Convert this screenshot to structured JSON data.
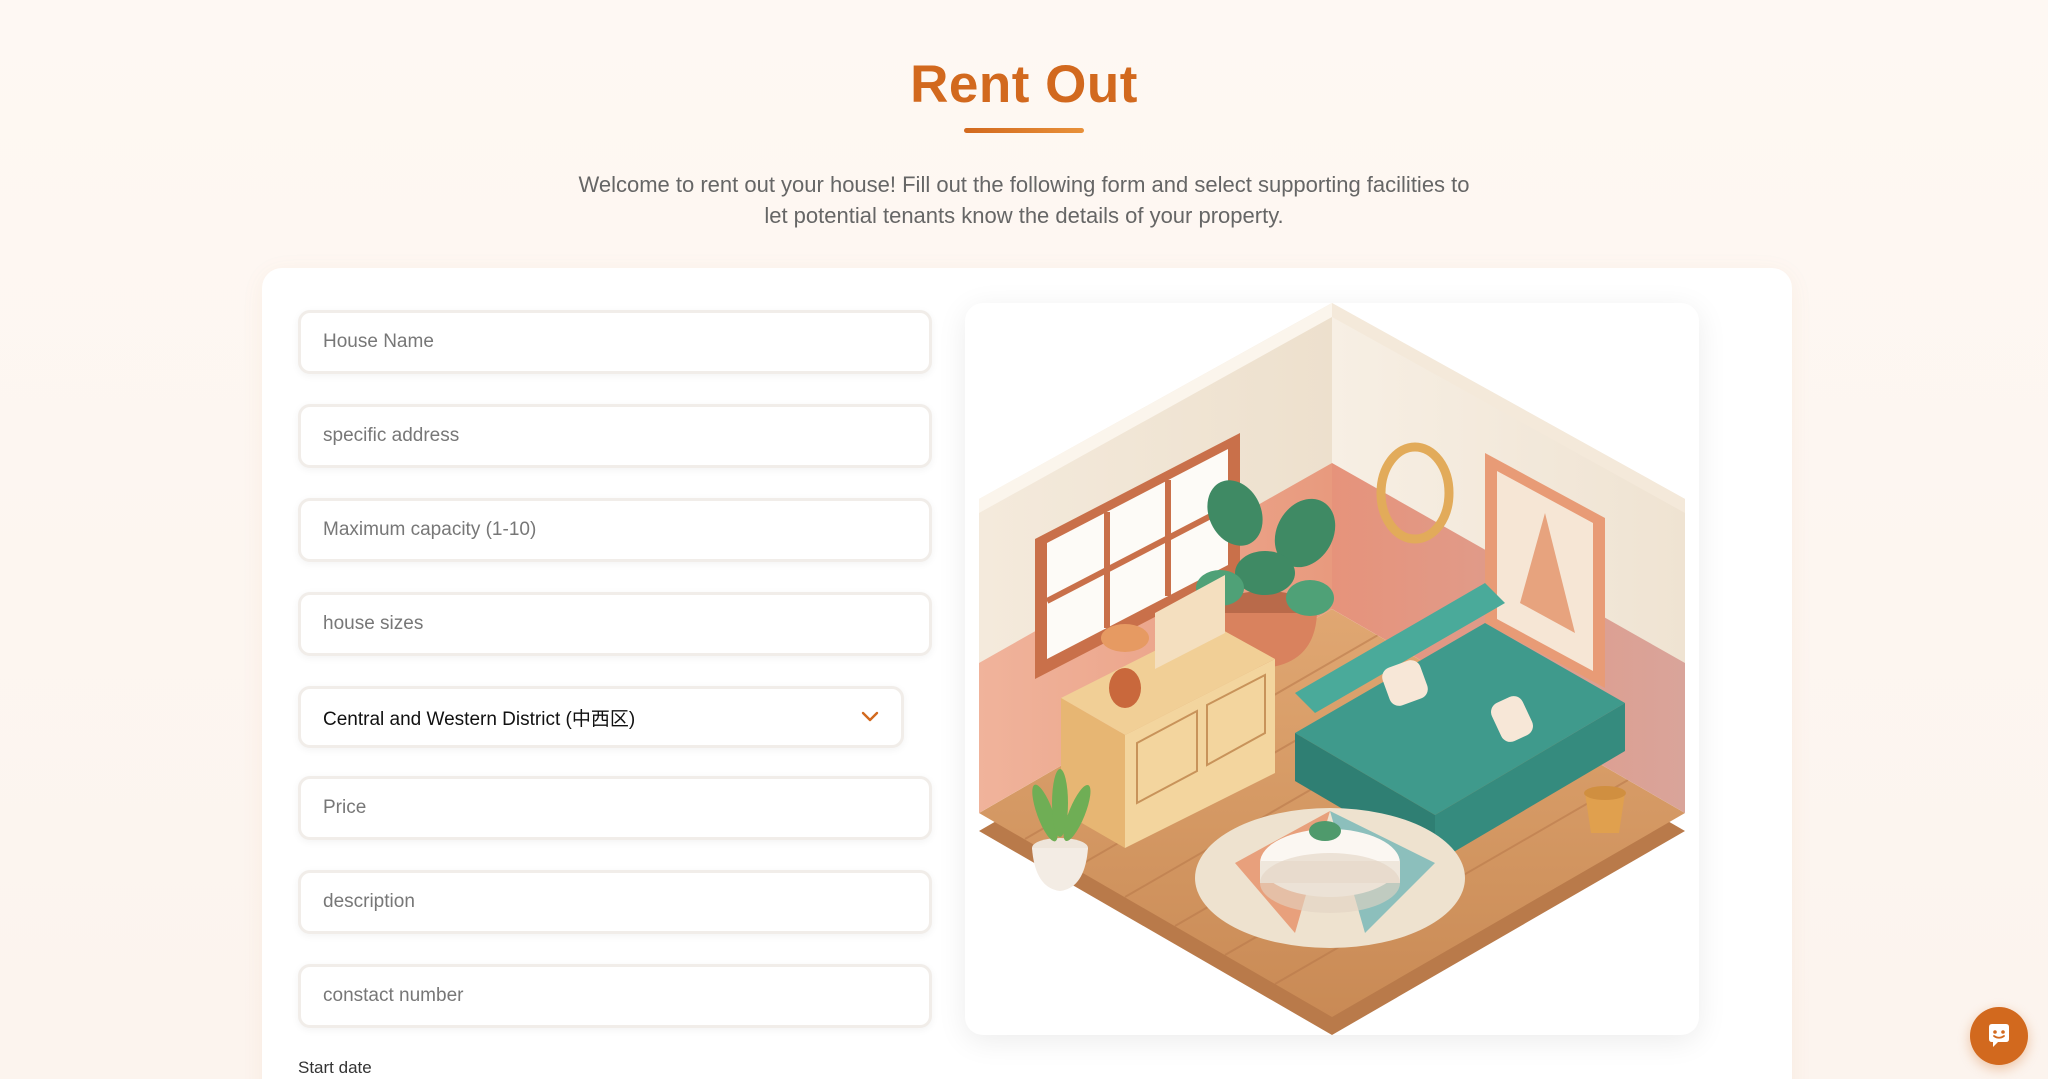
{
  "header": {
    "title": "Rent Out",
    "subtitle": "Welcome to rent out your house! Fill out the following form and select supporting facilities to let potential tenants know the details of your property."
  },
  "form": {
    "house_name_placeholder": "House Name",
    "address_placeholder": "specific address",
    "capacity_placeholder": "Maximum capacity (1-10)",
    "size_placeholder": "house sizes",
    "district_selected": "Central and Western District (中西区)",
    "price_placeholder": "Price",
    "description_placeholder": "description",
    "contact_placeholder": "constact number",
    "start_date_label": "Start date"
  },
  "icons": {
    "district_dropdown": "chevron-down-icon",
    "chat": "chat-bubble-icon"
  },
  "colors": {
    "accent": "#d2691e",
    "background": "#fdf6f0",
    "card": "#ffffff"
  }
}
